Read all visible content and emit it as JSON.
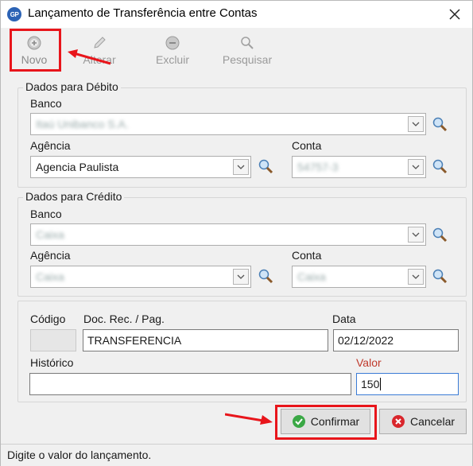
{
  "window": {
    "title": "Lançamento de Transferência entre Contas",
    "app_icon_text": "GP"
  },
  "toolbar": {
    "novo": "Novo",
    "alterar": "Alterar",
    "excluir": "Excluir",
    "pesquisar": "Pesquisar"
  },
  "debito": {
    "legend": "Dados para Débito",
    "banco_label": "Banco",
    "banco_value": "Itaú Unibanco S.A.",
    "agencia_label": "Agência",
    "agencia_value": "Agencia Paulista",
    "conta_label": "Conta",
    "conta_value": "54757-3"
  },
  "credito": {
    "legend": "Dados para Crédito",
    "banco_label": "Banco",
    "banco_value": "Caixa",
    "agencia_label": "Agência",
    "agencia_value": "Caixa",
    "conta_label": "Conta",
    "conta_value": "Caixa"
  },
  "lancamento": {
    "codigo_label": "Código",
    "codigo_value": "",
    "doc_label": "Doc. Rec. / Pag.",
    "doc_value": "TRANSFERENCIA",
    "data_label": "Data",
    "data_value": "02/12/2022",
    "historico_label": "Histórico",
    "historico_value": "",
    "valor_label": "Valor",
    "valor_value": "150"
  },
  "actions": {
    "confirmar": "Confirmar",
    "cancelar": "Cancelar"
  },
  "status": {
    "message": "Digite o valor do lançamento."
  },
  "colors": {
    "highlight": "#e8151b",
    "confirm": "#3aa845",
    "cancel": "#d9262c",
    "required_label": "#c0392b"
  }
}
